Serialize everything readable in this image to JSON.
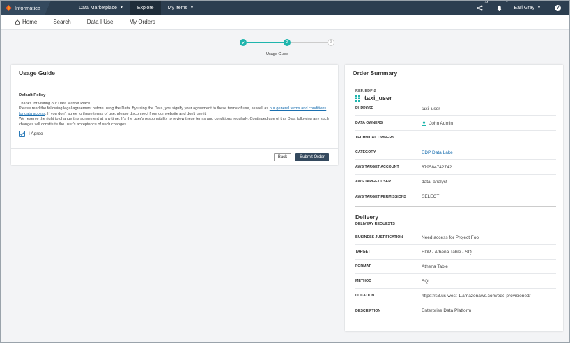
{
  "topbar": {
    "brand": "Informatica",
    "nav": [
      {
        "label": "Data Marketplace",
        "has_caret": true,
        "active": false
      },
      {
        "label": "Explore",
        "has_caret": false,
        "active": true
      },
      {
        "label": "My Items",
        "has_caret": true,
        "active": false
      }
    ],
    "notifications_badge": "44",
    "alerts_badge": "7",
    "user": "Earl Gray",
    "help": "?"
  },
  "subnav": {
    "home": "Home",
    "search": "Search",
    "data_i_use": "Data I Use",
    "my_orders": "My Orders"
  },
  "stepper": {
    "steps": [
      "1",
      "2",
      "3"
    ],
    "current_label": "Usage Guide"
  },
  "usage_guide": {
    "title": "Usage Guide",
    "policy_title": "Default Policy",
    "line1": "Thanks for visiting our Data Market Place.",
    "line2_pre": "Please read the following legal agreement before using the Data. By using the Data, you signify your agreement to these terms of use, as well as ",
    "line2_link": "our general terms and conditions for data access",
    "line2_post": ". If you don't agree to these terms of use, please disconnect from our website and don't use it.",
    "line3": "We reserve the right to change this agreement at any time. It's the user's responsibility to review these terms and conditions regularly. Continued use of this Data following any such changes will constitute the user's acceptance of such changes.",
    "agree_label": "I Agree",
    "agree_checked": true,
    "back_label": "Back",
    "submit_label": "Submit Order"
  },
  "order_summary": {
    "title": "Order Summary",
    "ref": "REF. EDP-2",
    "name": "taxi_user",
    "fields": [
      {
        "key": "PURPOSE",
        "value": "taxi_user"
      },
      {
        "key": "DATA OWNERS",
        "value": "John Admin"
      },
      {
        "key": "TECHNICAL OWNERS",
        "value": ""
      },
      {
        "key": "CATEGORY",
        "value": "EDP Data Lake"
      },
      {
        "key": "AWS TARGET ACCOUNT",
        "value": "879584742742"
      },
      {
        "key": "AWS TARGET USER",
        "value": "data_analyst"
      },
      {
        "key": "AWS TARGET PERMISSIONS",
        "value": "SELECT"
      }
    ],
    "delivery_title": "Delivery",
    "delivery_requests": "DELIVERY REQUESTS",
    "delivery_fields": [
      {
        "key": "BUSINESS JUSTIFICATION",
        "value": "Need access for Project Foo"
      },
      {
        "key": "TARGET",
        "value": "EDP - Athena Table - SQL"
      },
      {
        "key": "FORMAT",
        "value": "Athena Table"
      },
      {
        "key": "METHOD",
        "value": "SQL"
      },
      {
        "key": "LOCATION",
        "value": "https://s3.us-west-1.amazonaws.com/edc-provisioned/"
      },
      {
        "key": "DESCRIPTION",
        "value": "Enterprise Data Platform"
      }
    ]
  },
  "colors": {
    "topbar": "#2c3e50",
    "accent": "#1fb5ad",
    "link": "#1a6fb0",
    "brand_orange": "#e8542a"
  }
}
